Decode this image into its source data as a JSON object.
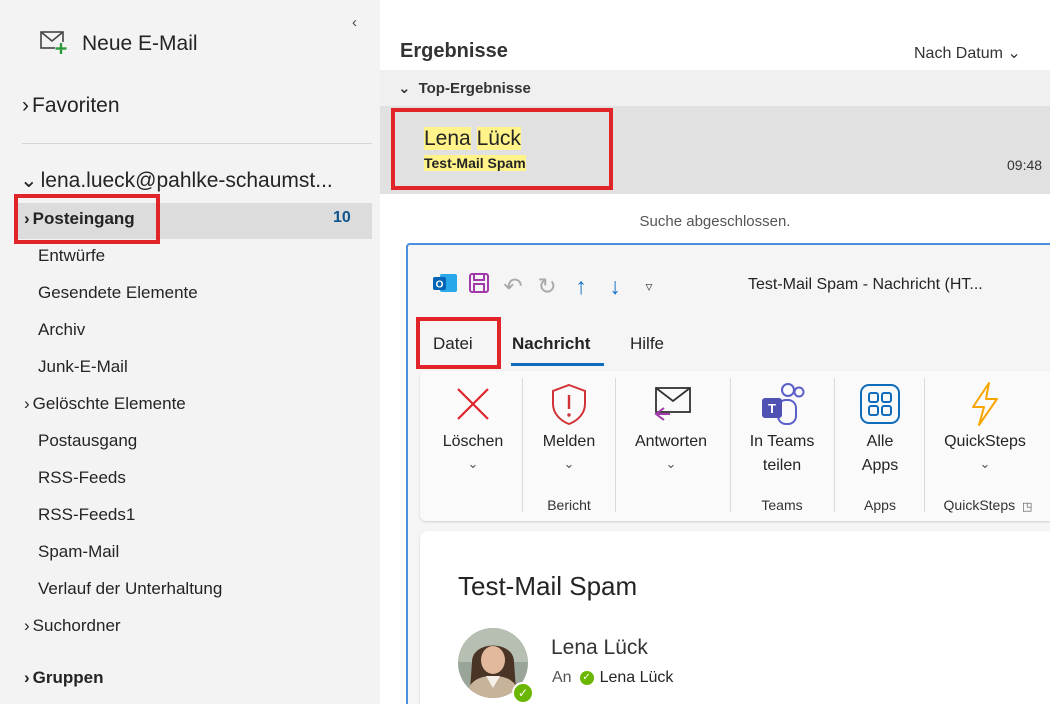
{
  "nav": {
    "new_mail": "Neue E-Mail",
    "favorites": "Favoriten",
    "account": "lena.lueck@pahlke-schaumst...",
    "inbox": {
      "label": "Posteingang",
      "count": "10"
    },
    "folders": [
      "Entwürfe",
      "Gesendete Elemente",
      "Archiv",
      "Junk-E-Mail",
      "Gelöschte Elemente",
      "Postausgang",
      "RSS-Feeds",
      "RSS-Feeds1",
      "Spam-Mail",
      "Verlauf der Unterhaltung",
      "Suchordner"
    ],
    "groups": "Gruppen"
  },
  "results": {
    "title": "Ergebnisse",
    "sort": "Nach Datum",
    "top_header": "Top-Ergebnisse",
    "item": {
      "sender_first": "Lena",
      "sender_last": "Lück",
      "subject": "Test-Mail Spam",
      "time": "09:48"
    },
    "status": "Suche abgeschlossen."
  },
  "message_window": {
    "title": "Test-Mail Spam  -  Nachricht (HT...",
    "tabs": [
      "Datei",
      "Nachricht",
      "Hilfe"
    ],
    "ribbon": {
      "delete": "Löschen",
      "report": "Melden",
      "reply": "Antworten",
      "teams_line1": "In Teams",
      "teams_line2": "teilen",
      "apps_line1": "Alle",
      "apps_line2": "Apps",
      "quicksteps": "QuickSteps"
    },
    "groups": {
      "report": "Bericht",
      "teams": "Teams",
      "apps": "Apps",
      "quicksteps": "QuickSteps"
    },
    "subject": "Test-Mail Spam",
    "sender": "Lena Lück",
    "to_label": "An",
    "to_name": "Lena Lück"
  },
  "colors": {
    "accent": "#0f6cbd",
    "highlight": "#fff38a",
    "annotation": "#e0242a",
    "presence": "#6bb700"
  }
}
